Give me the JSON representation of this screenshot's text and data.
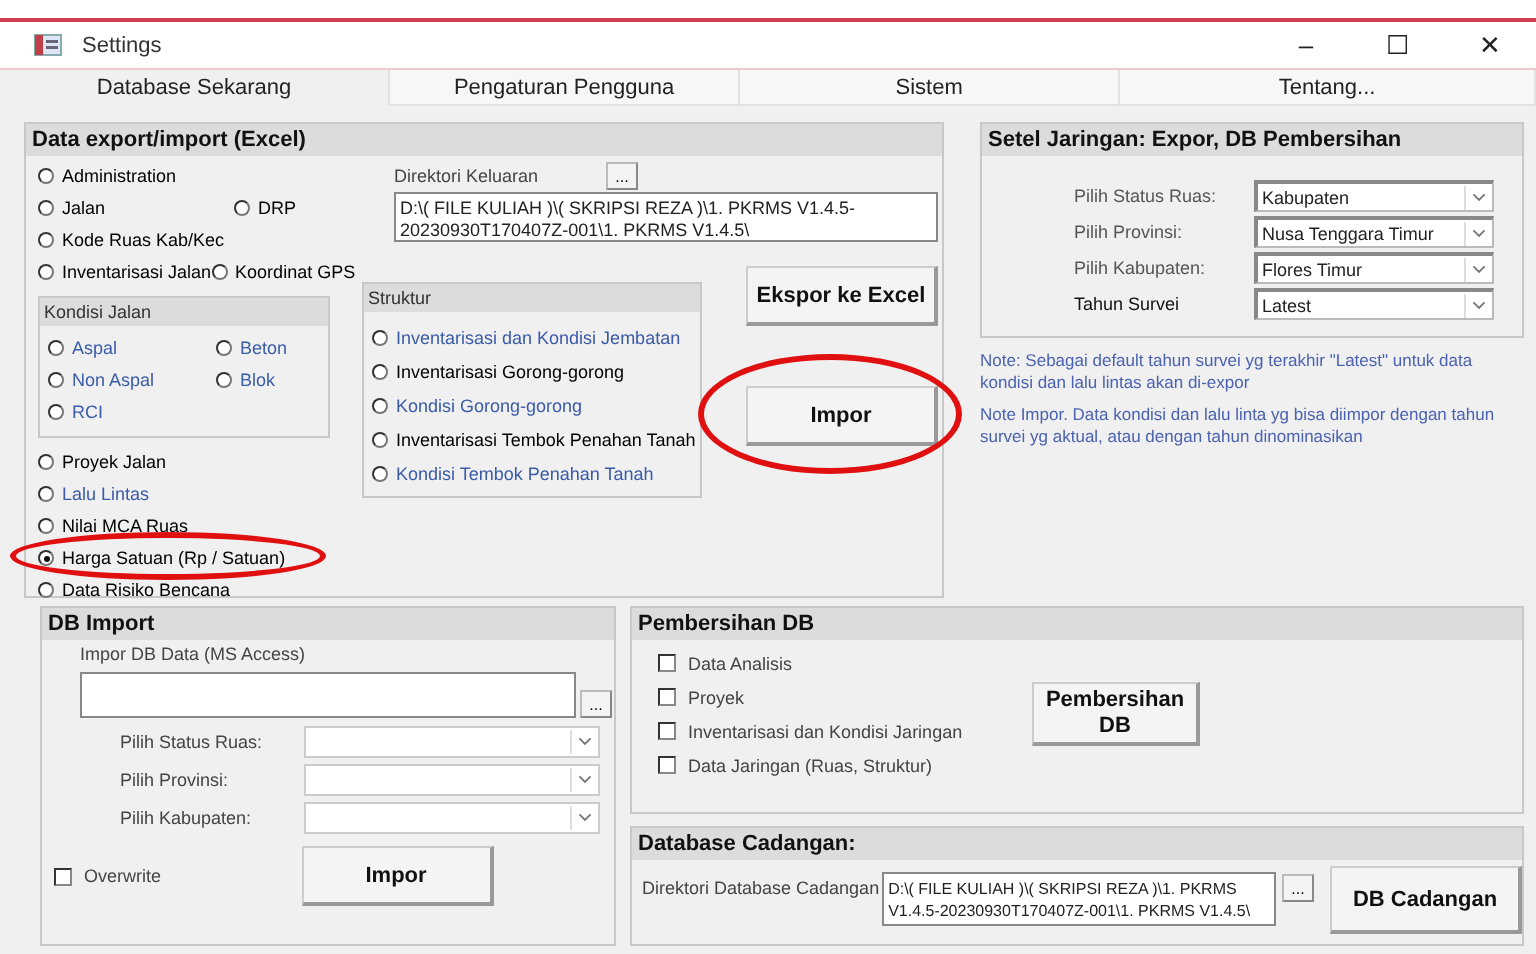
{
  "window": {
    "title": "Settings",
    "controls": [
      "–",
      "☐",
      "✕"
    ]
  },
  "tabs": [
    {
      "label": "Database Sekarang",
      "selected": true
    },
    {
      "label": "Pengaturan Pengguna",
      "selected": false
    },
    {
      "label": "Sistem",
      "selected": false
    },
    {
      "label": "Tentang...",
      "selected": false
    }
  ],
  "export_import": {
    "title": "Data export/import (Excel)",
    "top_radios": [
      [
        {
          "label": "Administration",
          "selected": false,
          "color": "#000000"
        }
      ],
      [
        {
          "label": "Jalan",
          "selected": false,
          "color": "#000000"
        },
        {
          "label": "DRP",
          "selected": false,
          "color": "#000000"
        }
      ],
      [
        {
          "label": "Kode Ruas Kab/Kec",
          "selected": false,
          "color": "#000000"
        }
      ],
      [
        {
          "label": "Inventarisasi Jalan",
          "selected": false,
          "color": "#000000"
        },
        {
          "label": "Koordinat GPS",
          "selected": false,
          "color": "#000000"
        }
      ]
    ],
    "kondisi": {
      "title": "Kondisi Jalan",
      "rows": [
        [
          {
            "label": "Aspal",
            "selected": false,
            "color": "#3a5ba8"
          },
          {
            "label": "Beton",
            "selected": false,
            "color": "#3a5ba8"
          }
        ],
        [
          {
            "label": "Non Aspal",
            "selected": false,
            "color": "#3a5ba8"
          },
          {
            "label": "Blok",
            "selected": false,
            "color": "#3a5ba8"
          }
        ],
        [
          {
            "label": "RCI",
            "selected": false,
            "color": "#3a5ba8"
          }
        ]
      ]
    },
    "bottom_radios": [
      {
        "label": "Proyek Jalan",
        "selected": false,
        "color": "#000000",
        "circled": false
      },
      {
        "label": "Lalu Lintas",
        "selected": false,
        "color": "#3a5ba8",
        "circled": false
      },
      {
        "label": "Nilai MCA Ruas",
        "selected": false,
        "color": "#000000",
        "circled": false
      },
      {
        "label": "Harga Satuan (Rp / Satuan)",
        "selected": true,
        "color": "#000000",
        "circled": true
      },
      {
        "label": "Data Risiko Bencana",
        "selected": false,
        "color": "#000000",
        "circled": false
      }
    ],
    "output_dir": {
      "label": "Direktori Keluaran",
      "browse": "...",
      "value": "D:\\( FILE KULIAH )\\( SKRIPSI REZA )\\1. PKRMS V1.4.5-20230930T170407Z-001\\1. PKRMS V1.4.5\\"
    },
    "struktur": {
      "title": "Struktur",
      "items": [
        {
          "label": "Inventarisasi dan Kondisi Jembatan",
          "selected": false,
          "color": "#3a5ba8"
        },
        {
          "label": "Inventarisasi Gorong-gorong",
          "selected": false,
          "color": "#000000"
        },
        {
          "label": "Kondisi Gorong-gorong",
          "selected": false,
          "color": "#3a5ba8"
        },
        {
          "label": "Inventarisasi Tembok Penahan Tanah",
          "selected": false,
          "color": "#000000"
        },
        {
          "label": "Kondisi Tembok Penahan Tanah",
          "selected": false,
          "color": "#3a5ba8"
        }
      ]
    },
    "buttons": [
      {
        "label": "Ekspor ke Excel",
        "circled": false
      },
      {
        "label": "Impor",
        "circled": true
      }
    ]
  },
  "network": {
    "title": "Setel Jaringan: Expor, DB Pembersihan",
    "fields": [
      {
        "label": "Pilih Status Ruas:",
        "value": "Kabupaten"
      },
      {
        "label": "Pilih Provinsi:",
        "value": "Nusa Tenggara Timur"
      },
      {
        "label": "Pilih Kabupaten:",
        "value": "Flores Timur"
      },
      {
        "label": "Tahun Survei",
        "value": "Latest"
      }
    ],
    "notes": [
      "Note: Sebagai default tahun survei yg terakhir \"Latest\" untuk data kondisi dan lalu lintas akan di-expor",
      "Note Impor. Data kondisi dan lalu linta yg bisa diimpor dengan tahun survei yg aktual, atau dengan tahun dinominasikan"
    ]
  },
  "db_import": {
    "title": "DB Import",
    "file_label": "Impor DB Data (MS Access)",
    "browse": "...",
    "fields": [
      {
        "label": "Pilih Status Ruas:"
      },
      {
        "label": "Pilih Provinsi:"
      },
      {
        "label": "Pilih Kabupaten:"
      }
    ],
    "overwrite": {
      "label": "Overwrite",
      "checked": false
    },
    "button": "Impor"
  },
  "cleanup": {
    "title": "Pembersihan DB",
    "items": [
      {
        "label": "Data Analisis",
        "checked": false
      },
      {
        "label": "Proyek",
        "checked": false
      },
      {
        "label": "Inventarisasi dan Kondisi Jaringan",
        "checked": false
      },
      {
        "label": "Data Jaringan (Ruas, Struktur)",
        "checked": false
      }
    ],
    "button": "Pembersihan DB"
  },
  "backup": {
    "title": "Database Cadangan:",
    "label": "Direktori Database Cadangan",
    "value": "D:\\( FILE KULIAH )\\( SKRIPSI REZA )\\1. PKRMS V1.4.5-20230930T170407Z-001\\1. PKRMS V1.4.5\\",
    "browse": "...",
    "button": "DB Cadangan"
  }
}
